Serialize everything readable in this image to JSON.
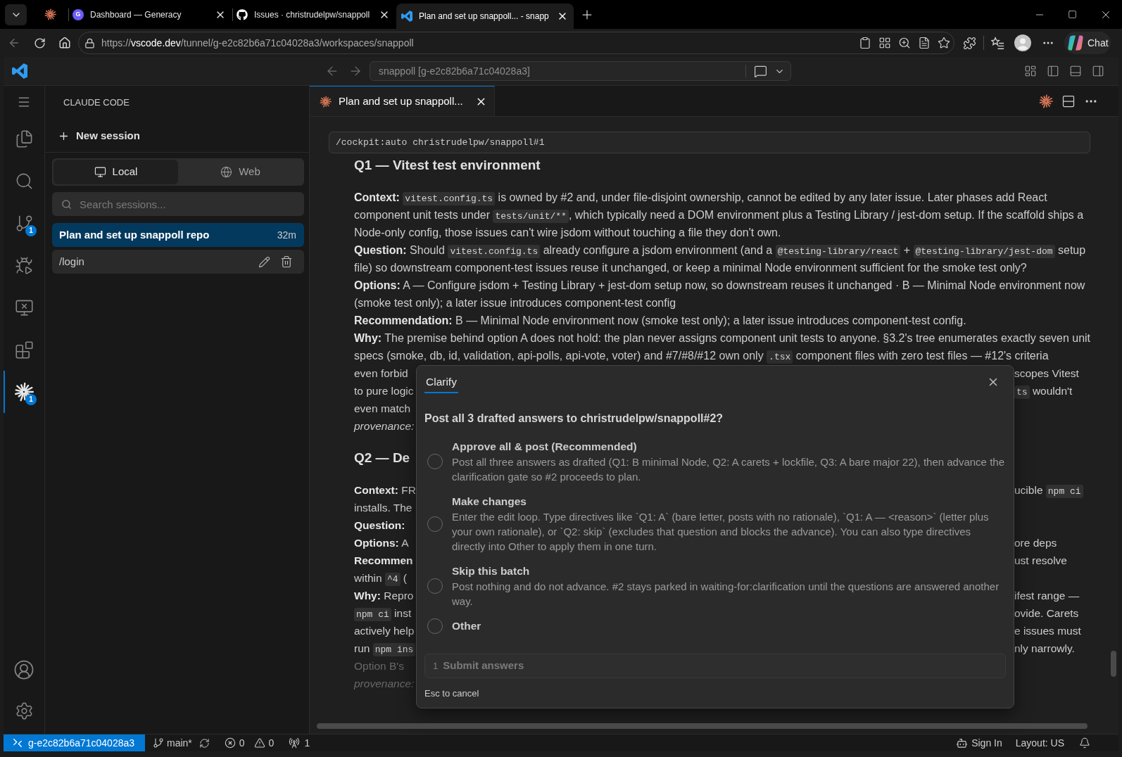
{
  "browser": {
    "tabs": [
      {
        "kind": "pinned",
        "selected": false
      },
      {
        "kind": "site",
        "favicon_text": "G",
        "title": "Dashboard — Generacy",
        "selected": false
      },
      {
        "kind": "site",
        "title": "Issues · christrudelpw/snappoll",
        "selected": false
      },
      {
        "kind": "site",
        "title": "Plan and set up snappoll... - snapp",
        "selected": true
      }
    ],
    "back_disabled": true,
    "url": {
      "scheme": "https://",
      "host": "vscode.dev",
      "path": "/tunnel/g-e2c82b6a71c04028a3/workspaces/snappoll"
    },
    "chat_button": "Chat"
  },
  "vscode": {
    "title_bar": {
      "back_disabled": true,
      "forward_disabled": true,
      "command_center": "snappoll [g-e2c82b6a71c04028a3]"
    },
    "activity_bar": [
      {
        "selected": false
      },
      {
        "selected": false
      },
      {
        "selected": false,
        "badge": "1"
      },
      {
        "selected": false
      },
      {
        "selected": false
      },
      {
        "selected": false
      },
      {
        "selected": true,
        "badge": "1"
      }
    ],
    "sidebar": {
      "title": "CLAUDE CODE",
      "new_session": "New session",
      "modes": [
        {
          "label": "Local",
          "selected": true
        },
        {
          "label": "Web",
          "selected": false
        }
      ],
      "search": {
        "placeholder": "Search sessions..."
      },
      "sessions": [
        {
          "title": "Plan and set up snappoll repo",
          "time": "32m",
          "selected": true,
          "hovered": false
        },
        {
          "title": "/login",
          "selected": false,
          "hovered": true
        }
      ]
    },
    "editor": {
      "tab": {
        "title": "Plan and set up snappoll...",
        "selected": true
      },
      "prompt": "/cockpit:auto christrudelpw/snappoll#1",
      "sections": [
        {
          "heading": "Q1 — Vitest test environment",
          "blocks": [
            {
              "kind": "paragraph",
              "segments": [
                {
                  "kind": "bold",
                  "text": "Context: "
                },
                {
                  "kind": "code",
                  "text": "vitest.config.ts"
                },
                {
                  "kind": "text",
                  "text": " is owned by #2 and, under file-disjoint ownership, cannot be edited by any later issue. Later phases add React component unit tests under "
                },
                {
                  "kind": "code",
                  "text": "tests/unit/**"
                },
                {
                  "kind": "text",
                  "text": ", which typically need a DOM environment plus a Testing Library / jest-dom setup. If the scaffold ships a Node-only config, those issues can't wire jsdom without touching a file they don't own."
                }
              ]
            },
            {
              "kind": "paragraph",
              "segments": [
                {
                  "kind": "bold",
                  "text": "Question:"
                },
                {
                  "kind": "text",
                  "text": " Should "
                },
                {
                  "kind": "code",
                  "text": "vitest.config.ts"
                },
                {
                  "kind": "text",
                  "text": " already configure a jsdom environment (and a "
                },
                {
                  "kind": "code",
                  "text": "@testing-library/react"
                },
                {
                  "kind": "text",
                  "text": " + "
                },
                {
                  "kind": "code",
                  "text": "@testing-library/jest-dom"
                },
                {
                  "kind": "text",
                  "text": " setup file) so downstream component-test issues reuse it unchanged, or keep a minimal Node environment sufficient for the smoke test only?"
                }
              ]
            },
            {
              "kind": "paragraph",
              "segments": [
                {
                  "kind": "bold",
                  "text": "Options:"
                },
                {
                  "kind": "text",
                  "text": " A — Configure jsdom + Testing Library + jest-dom setup now, so downstream reuses it unchanged · B — Minimal Node environment now (smoke test only); a later issue introduces component-test config"
                }
              ]
            },
            {
              "kind": "paragraph",
              "segments": [
                {
                  "kind": "bold",
                  "text": "Recommendation:"
                },
                {
                  "kind": "text",
                  "text": " B — Minimal Node environment now (smoke test only); a later issue introduces component-test config."
                }
              ]
            },
            {
              "kind": "paragraph",
              "segments": [
                {
                  "kind": "bold",
                  "text": "Why:"
                },
                {
                  "kind": "text",
                  "text": " The premise behind option A does not hold: the plan never assigns component unit tests to anyone. §3.2's tree enumerates exactly seven unit specs (smoke, db, id, validation, api-polls, api-vote, voter) and #7/#8/#12 own only "
                },
                {
                  "kind": "code",
                  "text": ".tsx"
                },
                {
                  "kind": "text",
                  "text": " component files with zero test files — #12's criteria"
                }
              ]
            },
            {
              "kind": "split_line",
              "left": [
                {
                  "kind": "text",
                  "text": "even forbid"
                }
              ],
              "right": [
                {
                  "kind": "text",
                  "text": "scopes Vitest"
                }
              ],
              "dimmed": false
            },
            {
              "kind": "split_line",
              "left": [
                {
                  "kind": "text",
                  "text": "to pure logic"
                }
              ],
              "right": [
                {
                  "kind": "code",
                  "text": "ts"
                },
                {
                  "kind": "text",
                  "text": " wouldn't"
                }
              ],
              "dimmed": false
            },
            {
              "kind": "split_line",
              "left": [
                {
                  "kind": "text",
                  "text": "even match"
                }
              ],
              "dimmed": false
            },
            {
              "kind": "split_line",
              "left": [
                {
                  "kind": "italic",
                  "text": "provenance:"
                }
              ],
              "dimmed": false
            }
          ]
        },
        {
          "heading": "Q2 — De",
          "blocks": [
            {
              "kind": "split_line",
              "left": [
                {
                  "kind": "bold",
                  "text": "Context:"
                },
                {
                  "kind": "text",
                  "text": " FR"
                }
              ],
              "right": [
                {
                  "kind": "text",
                  "text": "ucible "
                },
                {
                  "kind": "code",
                  "text": "npm ci"
                }
              ],
              "dimmed": false
            },
            {
              "kind": "split_line",
              "left": [
                {
                  "kind": "text",
                  "text": "installs. The"
                }
              ],
              "dimmed": false
            },
            {
              "kind": "split_line",
              "left": [
                {
                  "kind": "bold",
                  "text": "Question:"
                }
              ],
              "dimmed": false
            },
            {
              "kind": "split_line",
              "left": [
                {
                  "kind": "bold",
                  "text": "Options:"
                },
                {
                  "kind": "text",
                  "text": " A"
                }
              ],
              "right": [
                {
                  "kind": "text",
                  "text": "ore deps"
                }
              ],
              "dimmed": false
            },
            {
              "kind": "split_line",
              "left": [
                {
                  "kind": "bold",
                  "text": "Recommen"
                }
              ],
              "right": [
                {
                  "kind": "text",
                  "text": "ust resolve"
                }
              ],
              "dimmed": false
            },
            {
              "kind": "split_line",
              "left": [
                {
                  "kind": "text",
                  "text": "within "
                },
                {
                  "kind": "code",
                  "text": "^4"
                },
                {
                  "kind": "text",
                  "text": " ("
                }
              ],
              "dimmed": false
            },
            {
              "kind": "split_line",
              "left": [
                {
                  "kind": "bold",
                  "text": "Why:"
                },
                {
                  "kind": "text",
                  "text": " Repro"
                }
              ],
              "right": [
                {
                  "kind": "text",
                  "text": "ifest range —"
                }
              ],
              "dimmed": false
            },
            {
              "kind": "split_line",
              "left": [
                {
                  "kind": "code",
                  "text": "npm ci"
                },
                {
                  "kind": "text",
                  "text": " inst"
                }
              ],
              "right": [
                {
                  "kind": "text",
                  "text": "ovide. Carets"
                }
              ],
              "dimmed": false
            },
            {
              "kind": "split_line",
              "left": [
                {
                  "kind": "text",
                  "text": "actively help"
                }
              ],
              "right": [
                {
                  "kind": "text",
                  "text": "e issues must"
                }
              ],
              "dimmed": false
            },
            {
              "kind": "split_line",
              "left": [
                {
                  "kind": "text",
                  "text": "run "
                },
                {
                  "kind": "code",
                  "text": "npm ins"
                }
              ],
              "right": [
                {
                  "kind": "text",
                  "text": "nly narrowly."
                }
              ],
              "dimmed": false
            },
            {
              "kind": "split_line",
              "left": [
                {
                  "kind": "text",
                  "text": "Option B's"
                }
              ],
              "dimmed": true
            },
            {
              "kind": "split_line",
              "left": [
                {
                  "kind": "italic",
                  "text": "provenance:"
                }
              ],
              "dimmed": true
            }
          ]
        }
      ]
    },
    "dialog": {
      "tabs": [
        {
          "label": "Clarify",
          "selected": true
        }
      ],
      "question": "Post all 3 drafted answers to christrudelpw/snappoll#2?",
      "options": [
        {
          "title": "Approve all & post (Recommended)",
          "description": "Post all three answers as drafted (Q1: B minimal Node, Q2: A carets + lockfile, Q3: A bare major 22), then advance the clarification gate so #2 proceeds to plan.",
          "selected": false
        },
        {
          "title": "Make changes",
          "description": "Enter the edit loop. Type directives like `Q1: A` (bare letter, posts with no rationale), `Q1: A — <reason>` (letter plus your own rationale), or `Q2: skip` (excludes that question and blocks the advance). You can also type directives directly into Other to apply them in one turn.",
          "selected": false
        },
        {
          "title": "Skip this batch",
          "description": "Post nothing and do not advance. #2 stays parked in waiting-for:clarification until the questions are answered another way.",
          "selected": false
        },
        {
          "title": "Other",
          "selected": false
        }
      ],
      "submit": {
        "number": "1",
        "label": "Submit answers",
        "disabled": true
      },
      "hint": "Esc to cancel"
    },
    "status_bar": {
      "remote": "g-e2c82b6a71c04028a3",
      "branch": "main*",
      "errors": "0",
      "warnings": "0",
      "ports": "1",
      "sign_in": "Sign In",
      "layout": "Layout: US"
    }
  }
}
